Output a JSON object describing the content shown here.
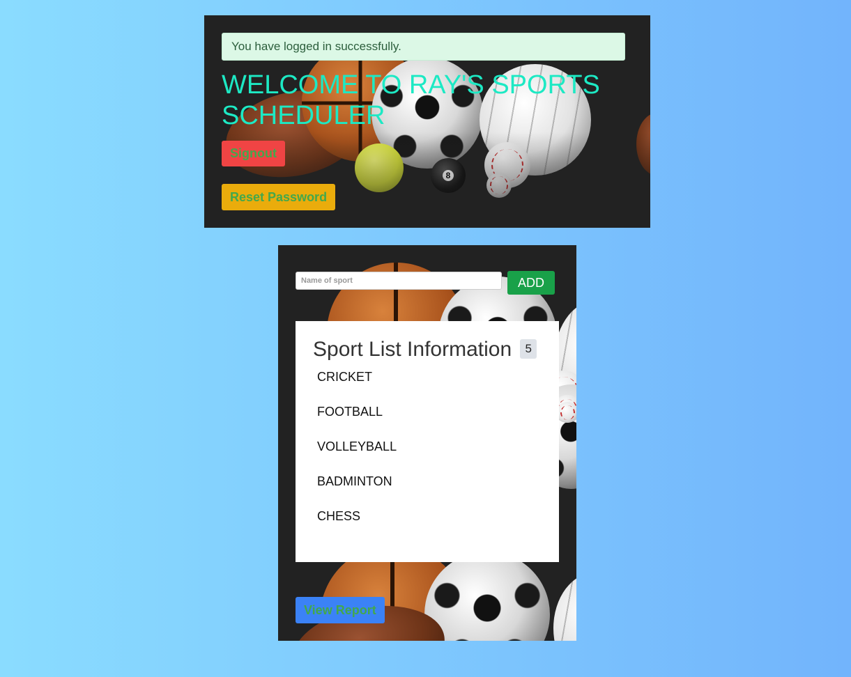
{
  "header": {
    "alert_text": "You have logged in successfully.",
    "welcome_title": "WELCOME TO RAY'S SPORTS SCHEDULER",
    "signout_label": "Signout",
    "reset_password_label": "Reset Password"
  },
  "sports_panel": {
    "input_placeholder": "Name of sport",
    "input_value": "",
    "add_label": "ADD",
    "list_title": "Sport List Information",
    "count": "5",
    "items": [
      "CRICKET",
      "FOOTBALL",
      "VOLLEYBALL",
      "BADMINTON",
      "CHESS"
    ],
    "view_report_label": "View Report"
  },
  "colors": {
    "page_gradient_start": "#8adcff",
    "page_gradient_end": "#72b4fc",
    "panel_bg": "#222222",
    "alert_bg": "#dcf8e6",
    "welcome_text": "#1de9c4",
    "signout_bg": "#f04444",
    "reset_bg": "#eaac0c",
    "button_text": "#43a84c",
    "add_bg": "#19a149",
    "report_bg": "#3b82f6"
  }
}
